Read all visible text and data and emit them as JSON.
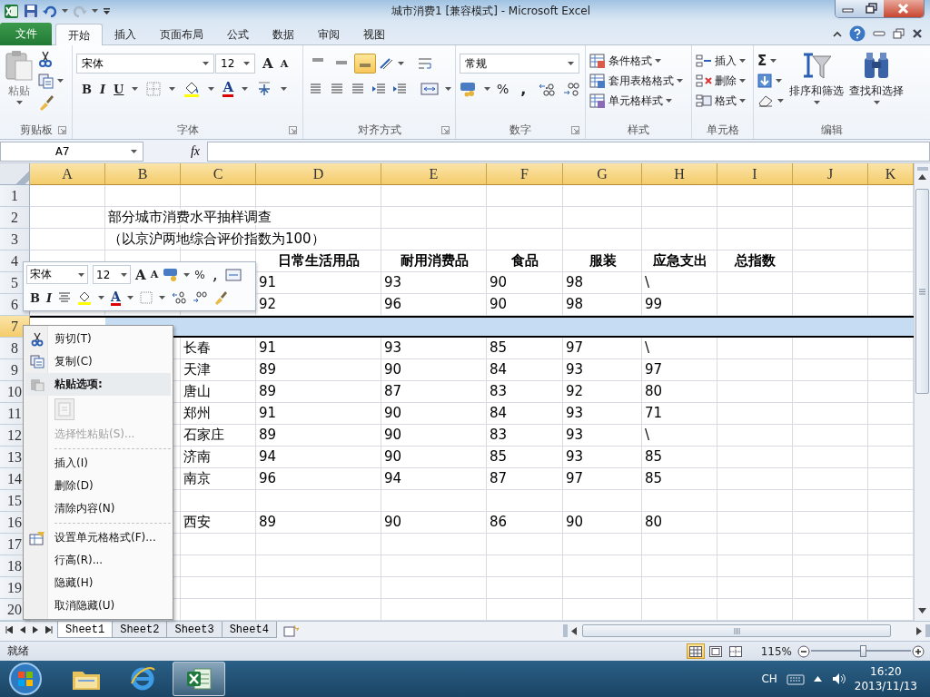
{
  "window": {
    "title": "城市消费1  [兼容模式]  -  Microsoft Excel"
  },
  "ribbon_tabs": [
    {
      "label": "文件",
      "kind": "file",
      "selected": false
    },
    {
      "label": "开始",
      "kind": "tab",
      "selected": true
    },
    {
      "label": "插入",
      "kind": "tab",
      "selected": false
    },
    {
      "label": "页面布局",
      "kind": "tab",
      "selected": false
    },
    {
      "label": "公式",
      "kind": "tab",
      "selected": false
    },
    {
      "label": "数据",
      "kind": "tab",
      "selected": false
    },
    {
      "label": "审阅",
      "kind": "tab",
      "selected": false
    },
    {
      "label": "视图",
      "kind": "tab",
      "selected": false
    }
  ],
  "ribbon": {
    "clipboard": {
      "paste": "粘贴",
      "label": "剪贴板"
    },
    "font": {
      "name": "宋体",
      "size": "12",
      "grow": "A",
      "shrink": "A",
      "bold": "B",
      "italic": "I",
      "underline": "U",
      "font_color": "A",
      "label": "字体"
    },
    "alignment": {
      "vertical": [
        {
          "selected": false
        },
        {
          "selected": false
        },
        {
          "selected": true
        }
      ],
      "label": "对齐方式"
    },
    "number": {
      "format": "常规",
      "percent": "%",
      "comma": ",",
      "label": "数字"
    },
    "styles": {
      "items": [
        "条件格式",
        "套用表格格式",
        "单元格样式"
      ],
      "label": "样式"
    },
    "cells": {
      "items": [
        "插入",
        "删除",
        "格式"
      ],
      "label": "单元格"
    },
    "editing": {
      "sum": "Σ",
      "sort": "排序和筛选",
      "find": "查找和选择",
      "label": "编辑"
    }
  },
  "formula_bar": {
    "name_box": "A7",
    "function_label": "fx"
  },
  "columns": [
    "A",
    "B",
    "C",
    "D",
    "E",
    "F",
    "G",
    "H",
    "I",
    "J",
    "K"
  ],
  "rows": [
    {
      "number": "1",
      "kind": "data",
      "selected": false
    },
    {
      "number": "2",
      "kind": "data",
      "selected": false,
      "cells": {
        "B": "部分城市消费水平抽样调查"
      }
    },
    {
      "number": "3",
      "kind": "data",
      "selected": false,
      "cells": {
        "B": "（以京沪两地综合评价指数为100）"
      }
    },
    {
      "number": "4",
      "kind": "header",
      "selected": false,
      "cells": {
        "D": "日常生活用品",
        "E": "耐用消费品",
        "F": "食品",
        "G": "服装",
        "H": "应急支出",
        "I": "总指数"
      }
    },
    {
      "number": "5",
      "kind": "data",
      "selected": false,
      "cells": {
        "D": "91",
        "E": "93",
        "F": "90",
        "G": "98",
        "H": "\\"
      }
    },
    {
      "number": "6",
      "kind": "data",
      "selected": false,
      "cells": {
        "D": "92",
        "E": "96",
        "F": "90",
        "G": "98",
        "H": "99"
      }
    },
    {
      "number": "7",
      "kind": "data",
      "selected": true
    },
    {
      "number": "8",
      "kind": "data",
      "selected": false,
      "cells": {
        "C": "长春",
        "D": "91",
        "E": "93",
        "F": "85",
        "G": "97",
        "H": "\\"
      }
    },
    {
      "number": "9",
      "kind": "data",
      "selected": false,
      "cells": {
        "C": "天津",
        "D": "89",
        "E": "90",
        "F": "84",
        "G": "93",
        "H": "97"
      }
    },
    {
      "number": "10",
      "kind": "data",
      "selected": false,
      "cells": {
        "C": "唐山",
        "D": "89",
        "E": "87",
        "F": "83",
        "G": "92",
        "H": "80"
      }
    },
    {
      "number": "11",
      "kind": "data",
      "selected": false,
      "cells": {
        "C": "郑州",
        "D": "91",
        "E": "90",
        "F": "84",
        "G": "93",
        "H": "71"
      }
    },
    {
      "number": "12",
      "kind": "data",
      "selected": false,
      "cells": {
        "C": "石家庄",
        "D": "89",
        "E": "90",
        "F": "83",
        "G": "93",
        "H": "\\"
      }
    },
    {
      "number": "13",
      "kind": "data",
      "selected": false,
      "cells": {
        "C": "济南",
        "D": "94",
        "E": "90",
        "F": "85",
        "G": "93",
        "H": "85"
      }
    },
    {
      "number": "14",
      "kind": "data",
      "selected": false,
      "cells": {
        "C": "南京",
        "D": "96",
        "E": "94",
        "F": "87",
        "G": "97",
        "H": "85"
      }
    },
    {
      "number": "15",
      "kind": "data",
      "selected": false
    },
    {
      "number": "16",
      "kind": "data",
      "selected": false,
      "cells": {
        "C": "西安",
        "D": "89",
        "E": "90",
        "F": "86",
        "G": "90",
        "H": "80"
      }
    },
    {
      "number": "17",
      "kind": "data",
      "selected": false
    },
    {
      "number": "18",
      "kind": "data",
      "selected": false
    },
    {
      "number": "19",
      "kind": "data",
      "selected": false
    },
    {
      "number": "20",
      "kind": "data",
      "selected": false
    }
  ],
  "mini_toolbar": {
    "font": "宋体",
    "size": "12",
    "grow": "A",
    "shrink": "A",
    "percent": "%",
    "comma": ",",
    "bold": "B",
    "italic": "I",
    "font_color": "A"
  },
  "context_menu": [
    {
      "kind": "command",
      "label": "剪切(T)",
      "disabled": false
    },
    {
      "kind": "command",
      "label": "复制(C)",
      "disabled": false
    },
    {
      "kind": "header",
      "label": "粘贴选项:",
      "disabled": false
    },
    {
      "kind": "paste-options",
      "disabled": true
    },
    {
      "kind": "command",
      "label": "选择性粘贴(S)...",
      "disabled": true
    },
    {
      "kind": "separator"
    },
    {
      "kind": "command",
      "label": "插入(I)",
      "disabled": false
    },
    {
      "kind": "command",
      "label": "删除(D)",
      "disabled": false
    },
    {
      "kind": "command",
      "label": "清除内容(N)",
      "disabled": false
    },
    {
      "kind": "separator"
    },
    {
      "kind": "command",
      "label": "设置单元格格式(F)...",
      "disabled": false
    },
    {
      "kind": "command",
      "label": "行高(R)...",
      "disabled": false
    },
    {
      "kind": "command",
      "label": "隐藏(H)",
      "disabled": false
    },
    {
      "kind": "command",
      "label": "取消隐藏(U)",
      "disabled": false
    }
  ],
  "sheet_tabs": [
    {
      "label": "Sheet1",
      "selected": true
    },
    {
      "label": "Sheet2",
      "selected": false
    },
    {
      "label": "Sheet3",
      "selected": false
    },
    {
      "label": "Sheet4",
      "selected": false
    }
  ],
  "status_bar": {
    "status": "就绪",
    "views": [
      {
        "selected": true
      },
      {
        "selected": false
      },
      {
        "selected": false
      }
    ],
    "zoom": "115%",
    "zoom_slider": {
      "level": 0.52
    }
  },
  "taskbar": {
    "apps": [
      {
        "kind": "explorer",
        "selected": false
      },
      {
        "kind": "browser",
        "selected": false
      },
      {
        "kind": "spreadsheet",
        "selected": true
      }
    ],
    "language": "CH",
    "time": "16:20",
    "date": "2013/11/13"
  }
}
